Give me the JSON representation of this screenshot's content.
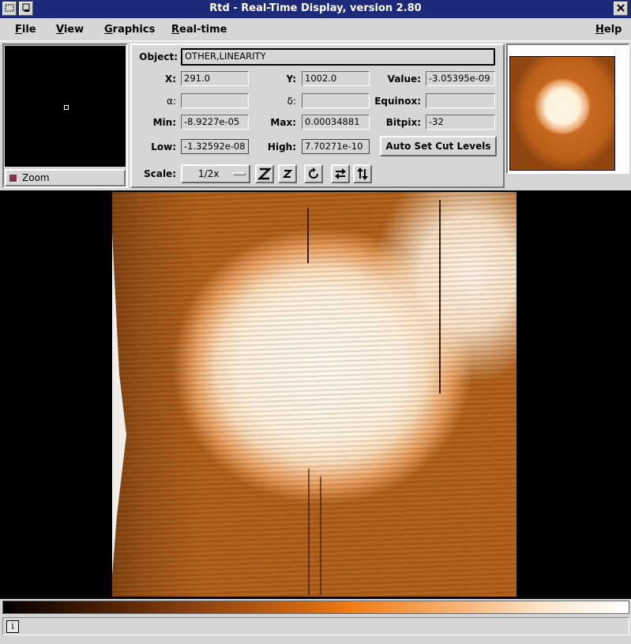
{
  "window": {
    "title": "Rtd - Real-Time Display, version 2.80"
  },
  "menubar": {
    "items": [
      {
        "label": "File",
        "key": "F",
        "rest": "ile"
      },
      {
        "label": "View",
        "key": "V",
        "rest": "iew"
      },
      {
        "label": "Graphics",
        "key": "G",
        "rest": "raphics"
      },
      {
        "label": "Real-time",
        "key": "R",
        "rest": "eal-time"
      },
      {
        "label": "Help",
        "key": "H",
        "rest": "elp"
      }
    ]
  },
  "zoom": {
    "label": "Zoom"
  },
  "info": {
    "object_label": "Object:",
    "object_value": "OTHER,LINEARITY",
    "x_label": "X:",
    "x_value": "291.0",
    "y_label": "Y:",
    "y_value": "1002.0",
    "value_label": "Value:",
    "value_value": "-3.05395e-09",
    "alpha_label": "α:",
    "alpha_value": "",
    "delta_label": "δ:",
    "delta_value": "",
    "equinox_label": "Equinox:",
    "equinox_value": "",
    "min_label": "Min:",
    "min_value": "-8.9227e-05",
    "max_label": "Max:",
    "max_value": "0.00034881",
    "bitpix_label": "Bitpix:",
    "bitpix_value": "-32",
    "low_label": "Low:",
    "low_value": "-1.32592e-08",
    "high_label": "High:",
    "high_value": "7.70271e-10",
    "autocut_label": "Auto Set Cut Levels",
    "scale_label": "Scale:",
    "scale_value": "1/2x"
  },
  "status": {
    "icon": "info-icon",
    "glyph": "i"
  },
  "colors": {
    "titlebar": "#1d2a7a",
    "colormap_dark": "#000000",
    "colormap_mid": "#f07a10",
    "colormap_light": "#ffffff"
  }
}
